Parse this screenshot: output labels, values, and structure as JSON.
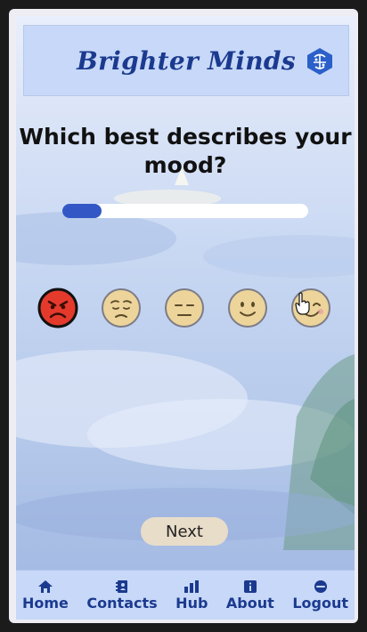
{
  "app": {
    "title": "Brighter Minds"
  },
  "question": {
    "text": "Which best describes your mood?"
  },
  "progress": {
    "fraction": 0.16
  },
  "moods": [
    {
      "name": "angry",
      "color": "#e43a2c",
      "selected": true
    },
    {
      "name": "sad",
      "color": "#ecd49a"
    },
    {
      "name": "neutral",
      "color": "#ecd49a"
    },
    {
      "name": "content",
      "color": "#ecd49a"
    },
    {
      "name": "happy",
      "color": "#ecd49a"
    }
  ],
  "actions": {
    "next_label": "Next"
  },
  "nav": [
    {
      "label": "Home",
      "icon": "home-icon"
    },
    {
      "label": "Contacts",
      "icon": "contacts-icon"
    },
    {
      "label": "Hub",
      "icon": "hub-icon"
    },
    {
      "label": "About",
      "icon": "info-icon"
    },
    {
      "label": "Logout",
      "icon": "logout-icon"
    }
  ],
  "colors": {
    "accent": "#1b3a8f",
    "header_bg": "#c7d8f8",
    "progress_fill": "#3358c6",
    "button_bg": "#e8ddc9"
  }
}
